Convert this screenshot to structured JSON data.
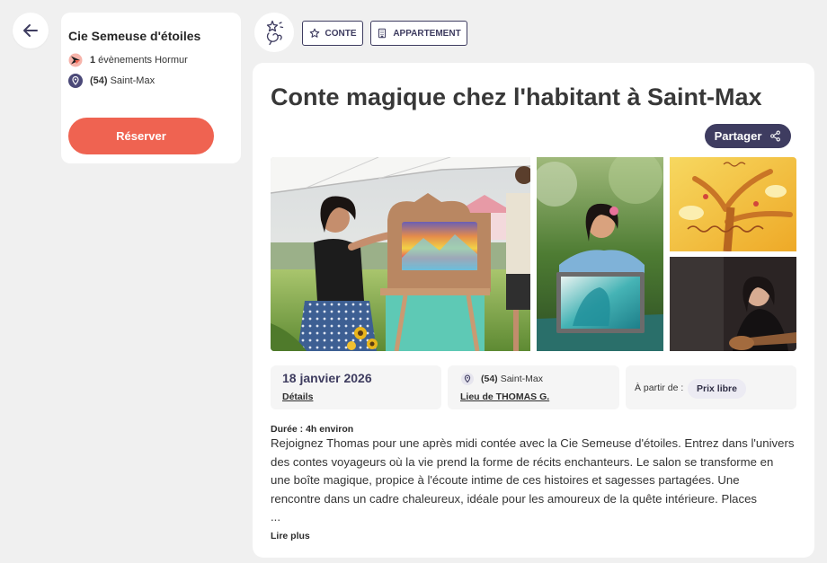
{
  "header": {
    "back_icon": "arrow-left-icon",
    "category_icon": "storyteller-doodle-icon"
  },
  "organizer": {
    "name": "Cie Semeuse d'étoiles",
    "events_icon": "hormur-logo-icon",
    "events_count": "1",
    "events_label": "évènements Hormur",
    "location_icon": "location-pin-icon",
    "department": "(54)",
    "city": "Saint-Max",
    "reserve_label": "Réserver"
  },
  "tags": [
    {
      "icon": "star-icon",
      "label": "CONTE"
    },
    {
      "icon": "building-icon",
      "label": "APPARTEMENT"
    }
  ],
  "event": {
    "title": "Conte magique chez l'habitant à Saint-Max",
    "share_label": "Partager",
    "share_icon": "share-icon",
    "date": "18 janvier 2026",
    "details_link": "Détails",
    "location": {
      "icon": "location-pin-icon",
      "department": "(54)",
      "city": "Saint-Max",
      "venue_link": "Lieu de THOMAS G."
    },
    "price": {
      "label": "À partir de :",
      "value": "Prix libre"
    },
    "duration": "Durée : 4h environ",
    "description": {
      "lines": [
        "Rejoignez Thomas pour une après midi contée avec la Cie Semeuse d'étoiles. Entrez dans l'univers",
        "des contes voyageurs où la vie prend la forme de récits enchanteurs. Le salon se transforme en",
        "une boîte magique, propice à l'écoute intime de ces histoires et sagesses partagées. Une",
        "rencontre dans un cadre chaleureux, idéale pour les amoureux de la quête intérieure. Places"
      ],
      "ellipsis": "..."
    },
    "read_more": "Lire plus"
  },
  "colors": {
    "page_background": "#f0f0f0",
    "accent": "#ef6351",
    "navy": "#3e3c60",
    "info_box": "#f5f5f5",
    "price_chip": "#ecebf3"
  }
}
